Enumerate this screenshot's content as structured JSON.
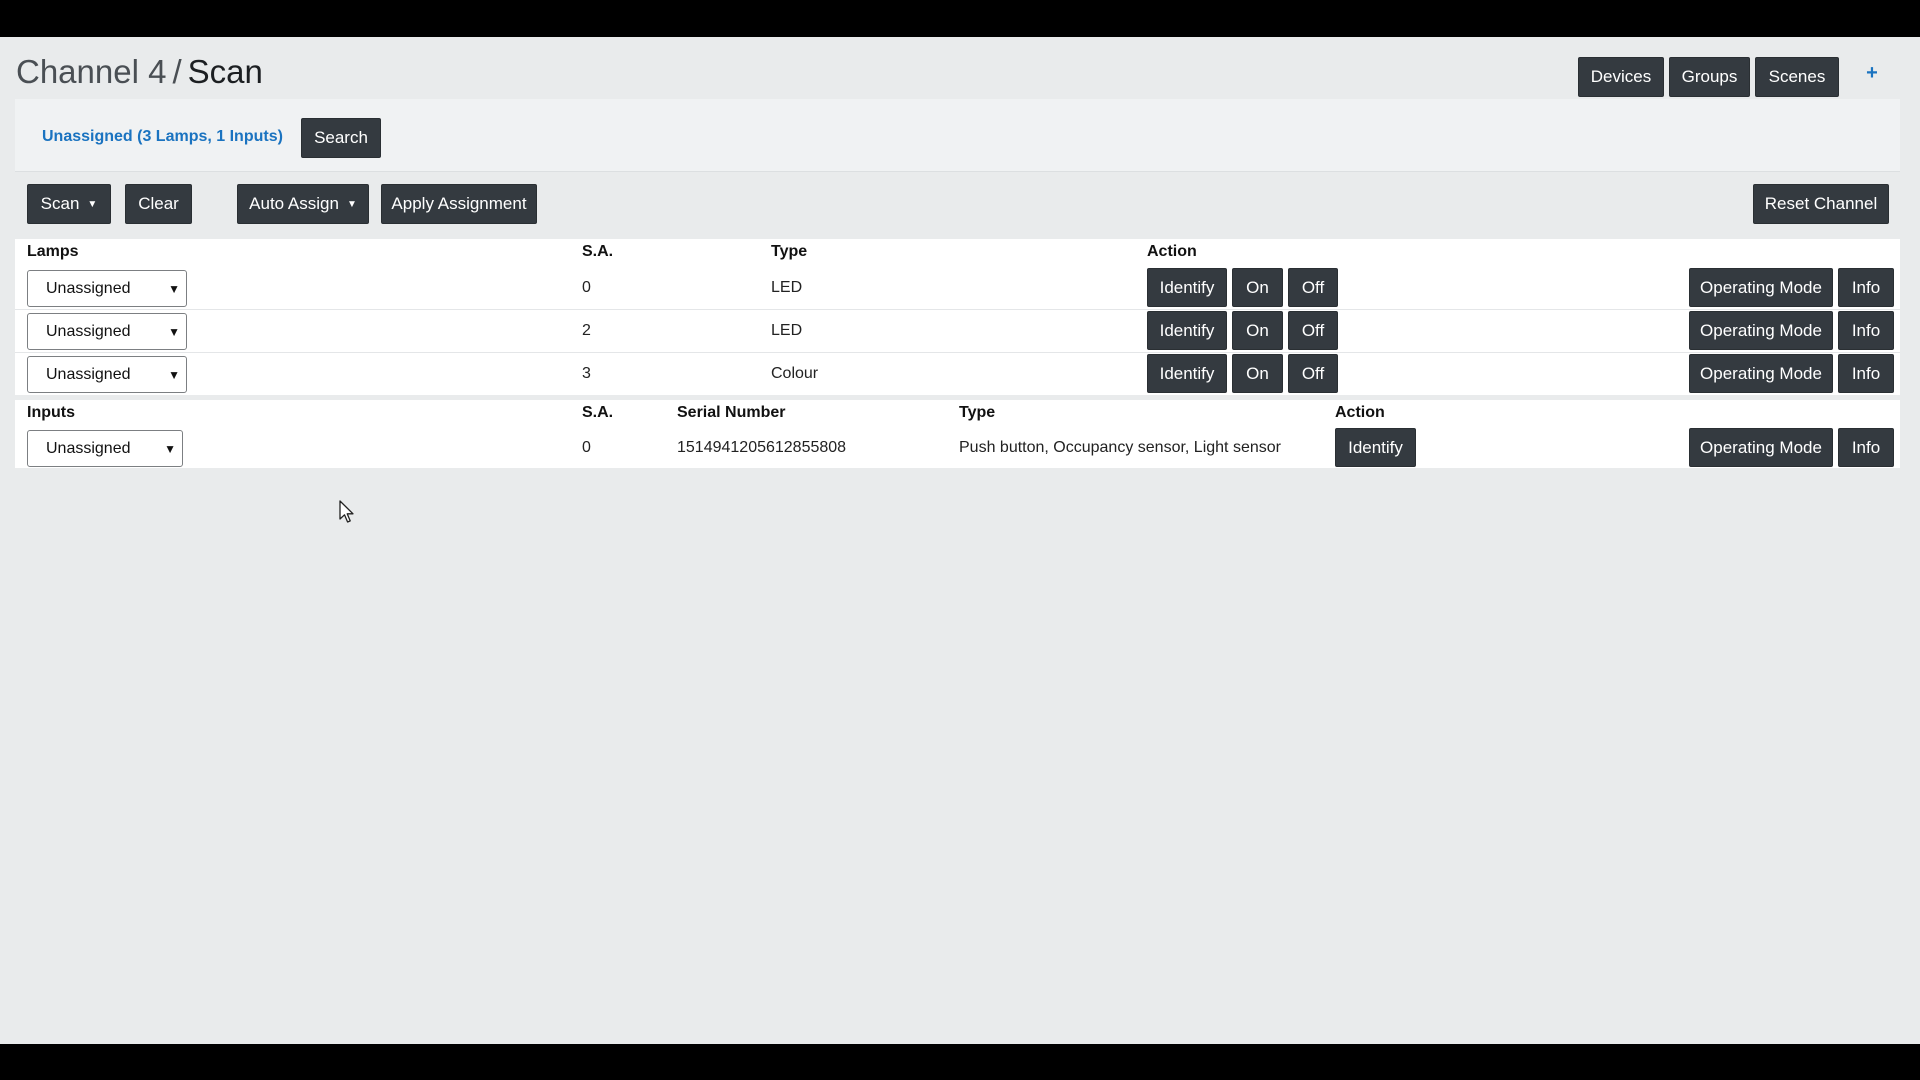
{
  "header": {
    "breadcrumb": "Channel 4",
    "separator": "/",
    "current": "Scan",
    "nav": {
      "devices": "Devices",
      "groups": "Groups",
      "scenes": "Scenes",
      "add": "+"
    }
  },
  "filter": {
    "label": "Unassigned (3 Lamps, 1 Inputs)",
    "search_label": "Search"
  },
  "toolbar": {
    "scan": "Scan",
    "clear": "Clear",
    "auto_assign": "Auto Assign",
    "apply_assignment": "Apply Assignment",
    "reset_channel": "Reset Channel"
  },
  "lamps": {
    "headers": {
      "name": "Lamps",
      "sa": "S.A.",
      "type": "Type",
      "action": "Action"
    },
    "rows": [
      {
        "assignment": "Unassigned",
        "sa": "0",
        "type": "LED"
      },
      {
        "assignment": "Unassigned",
        "sa": "2",
        "type": "LED"
      },
      {
        "assignment": "Unassigned",
        "sa": "3",
        "type": "Colour"
      }
    ]
  },
  "inputs": {
    "headers": {
      "name": "Inputs",
      "sa": "S.A.",
      "serial": "Serial Number",
      "type": "Type",
      "action": "Action"
    },
    "rows": [
      {
        "assignment": "Unassigned",
        "sa": "0",
        "serial": "1514941205612855808",
        "type": "Push button, Occupancy sensor, Light sensor"
      }
    ]
  },
  "actions": {
    "identify": "Identify",
    "on": "On",
    "off": "Off",
    "operating_mode": "Operating Mode",
    "info": "Info"
  },
  "colors": {
    "button_dark": "#343a40",
    "link_blue": "#1a73c0",
    "page_bg": "#e9ebec"
  }
}
